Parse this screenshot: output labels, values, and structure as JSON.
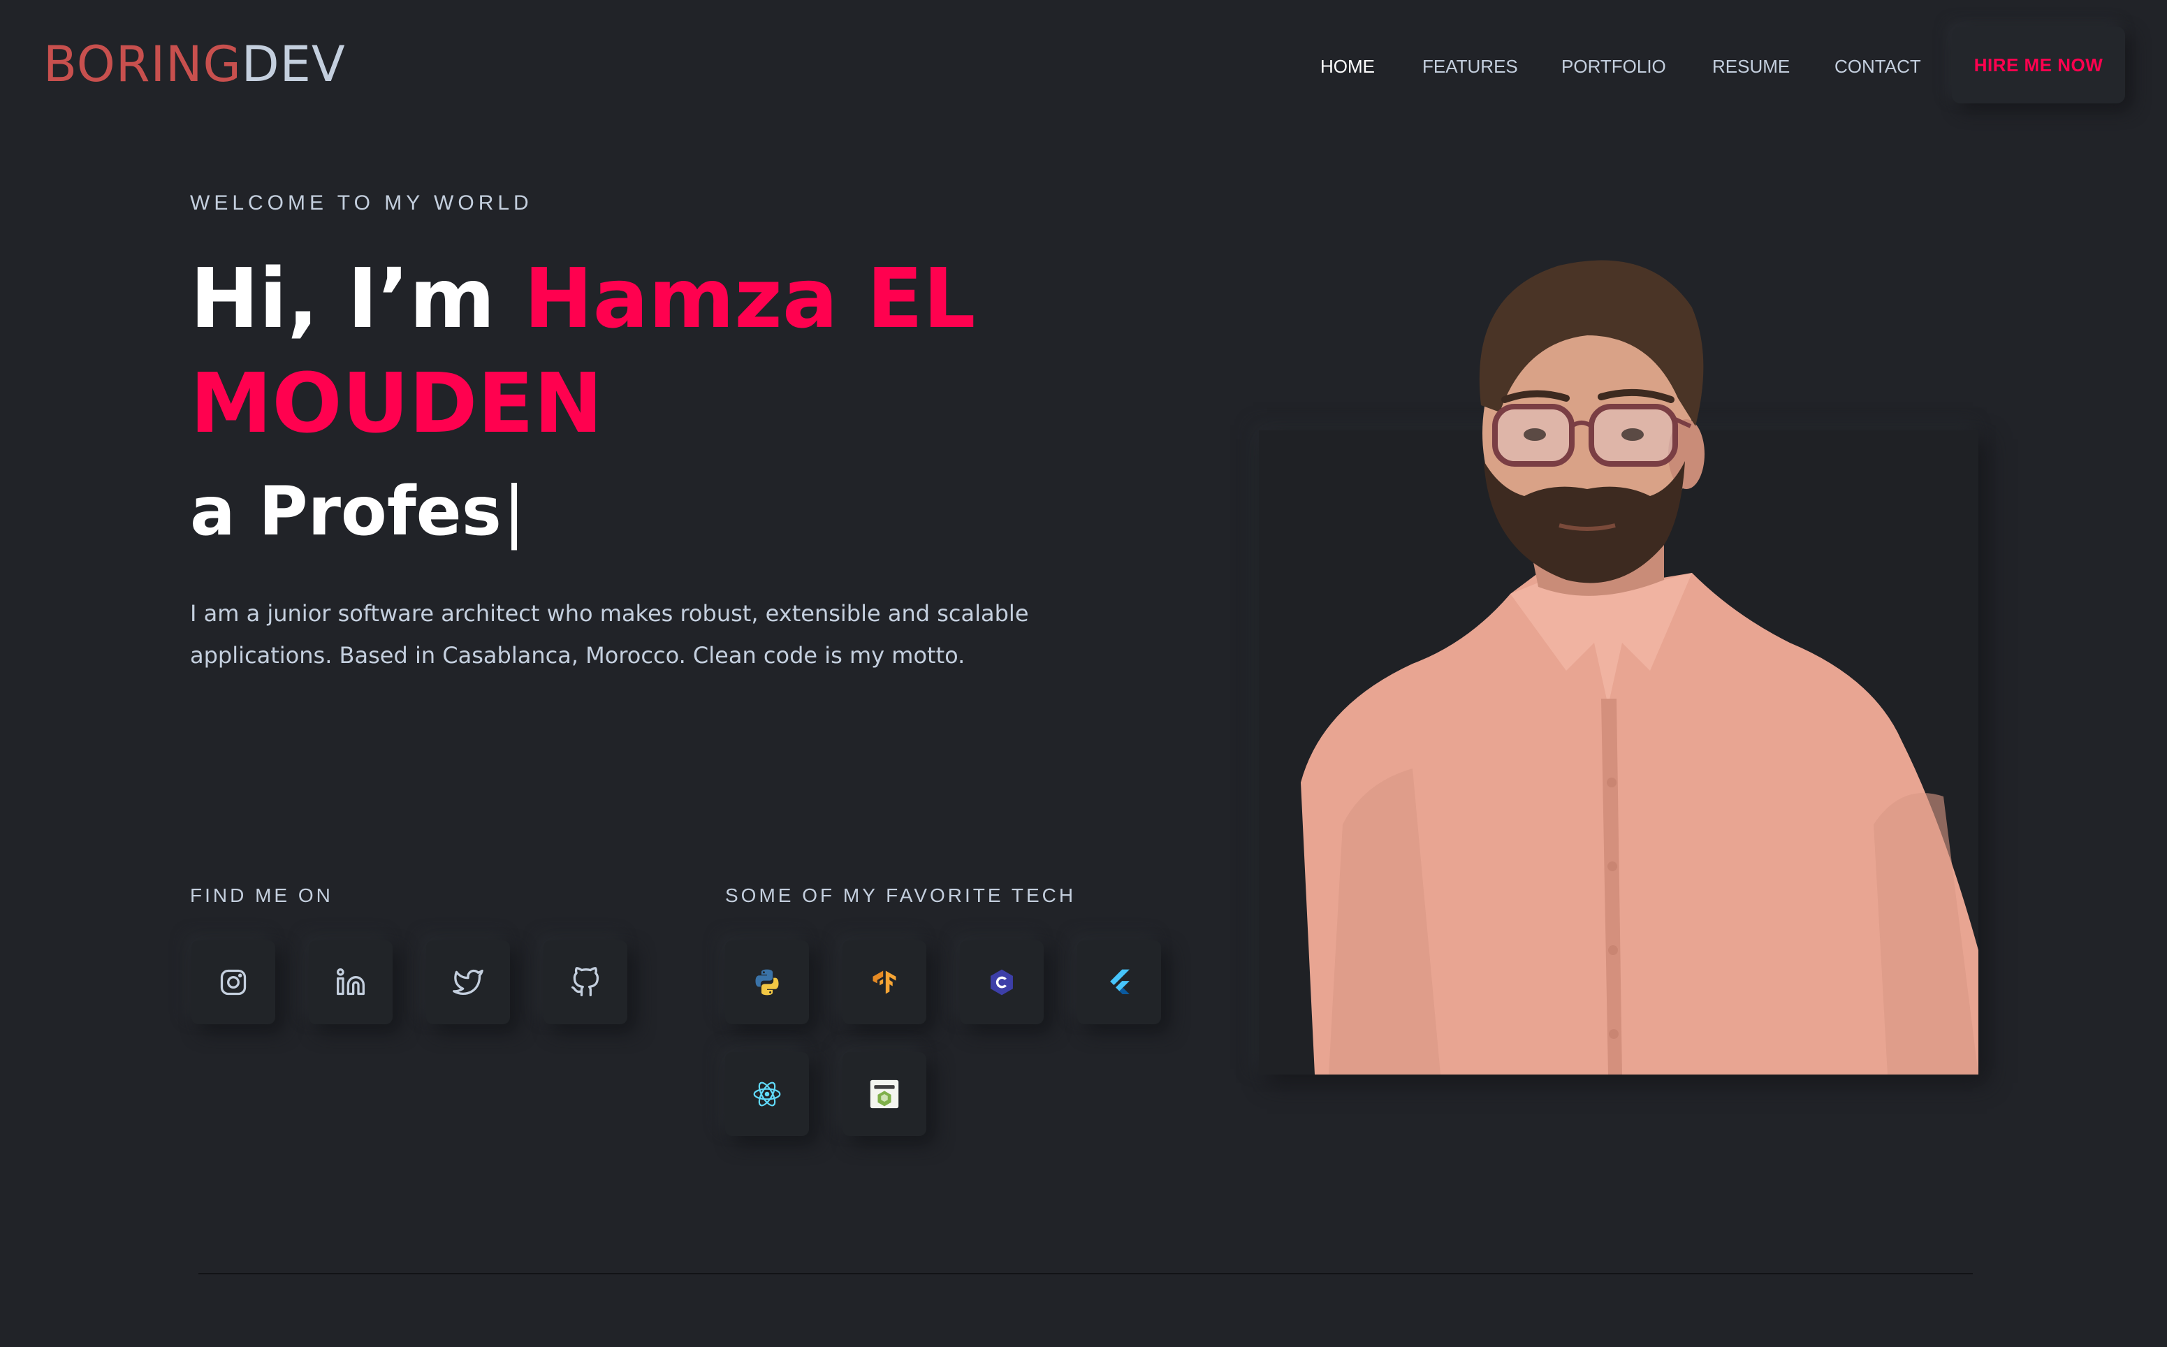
{
  "brand": {
    "logo_part1": "BORING",
    "logo_part2": "DEV"
  },
  "nav": {
    "items": [
      "HOME",
      "FEATURES",
      "PORTFOLIO",
      "RESUME",
      "CONTACT"
    ],
    "active": "HOME",
    "cta": "HIRE ME NOW"
  },
  "hero": {
    "welcome": "WELCOME TO MY WORLD",
    "greeting": "Hi, I’m ",
    "name": "Hamza EL MOUDEN",
    "typed": "a Profes",
    "typed_cursor": "|",
    "intro": "I am a junior software architect who makes robust, extensible and scalable applications. Based in Casablanca, Morocco. Clean code is my motto."
  },
  "social": {
    "label": "FIND ME ON",
    "icons": [
      "instagram-icon",
      "linkedin-icon",
      "twitter-icon",
      "github-icon"
    ]
  },
  "tech": {
    "label": "SOME OF MY FAVORITE TECH",
    "icons": [
      "python-icon",
      "tensorflow-icon",
      "c-language-icon",
      "flutter-icon",
      "react-icon",
      "nodejs-icon"
    ]
  },
  "colors": {
    "background": "#212328",
    "accent": "#ff014f",
    "logo_red": "#c8504e",
    "text": "#c4cfde",
    "heading": "#ffffff"
  }
}
